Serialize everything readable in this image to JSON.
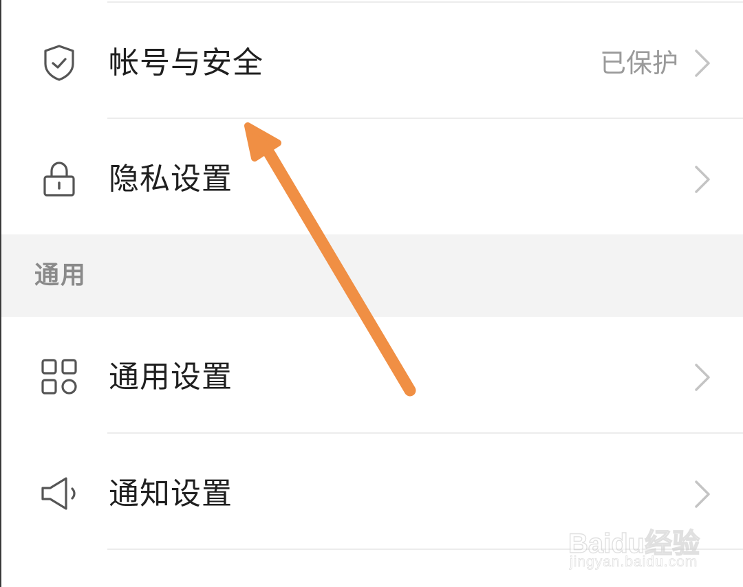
{
  "settings": {
    "account_security": {
      "label": "帐号与安全",
      "status": "已保护"
    },
    "privacy": {
      "label": "隐私设置"
    },
    "general_section": {
      "title": "通用"
    },
    "general_settings": {
      "label": "通用设置"
    },
    "notification_settings": {
      "label": "通知设置"
    }
  },
  "icons": {
    "account_security": "shield-check-icon",
    "privacy": "lock-icon",
    "general_settings": "grid-icon",
    "notification_settings": "speaker-icon",
    "chevron": "chevron-right-icon"
  },
  "annotation": {
    "arrow_color": "#F08F44"
  },
  "watermark": {
    "brand": "Baidu经验",
    "url": "jingyan.baidu.com"
  }
}
